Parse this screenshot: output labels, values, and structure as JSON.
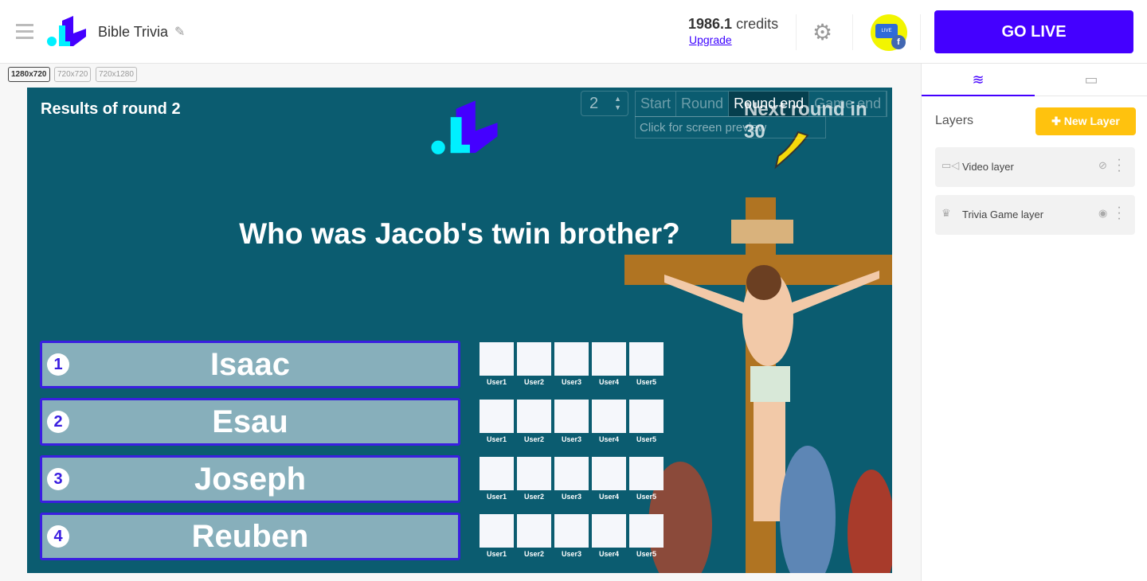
{
  "header": {
    "title": "Bible Trivia",
    "credits_value": "1986.1",
    "credits_label": "credits",
    "upgrade": "Upgrade",
    "go_live": "GO LIVE",
    "avatar_text": "LIVE",
    "avatar_badge": "f"
  },
  "resolutions": [
    {
      "label": "1280x720",
      "active": true
    },
    {
      "label": "720x720"
    },
    {
      "label": "720x1280"
    }
  ],
  "game": {
    "round_title": "Results of round 2",
    "question": "Who was Jacob's twin brother?",
    "round_number": "2",
    "stage_tabs": [
      "Start",
      "Round",
      "Round end",
      "Game end"
    ],
    "active_stage": "Round end",
    "preview": "Click for screen preview",
    "next_round": "Next round in 30",
    "answers": [
      {
        "num": "1",
        "text": "Isaac"
      },
      {
        "num": "2",
        "text": "Esau"
      },
      {
        "num": "3",
        "text": "Joseph"
      },
      {
        "num": "4",
        "text": "Reuben"
      }
    ],
    "users": [
      "User1",
      "User2",
      "User3",
      "User4",
      "User5"
    ]
  },
  "sidebar": {
    "layers_title": "Layers",
    "new_layer": "New Layer",
    "layers": [
      {
        "name": "Video layer",
        "icon": "video-camera-icon",
        "visible": false
      },
      {
        "name": "Trivia Game layer",
        "icon": "crown-icon",
        "visible": true
      }
    ]
  },
  "colors": {
    "accent": "#4400ff",
    "canvas": "#0b5c70",
    "answer": "#87afbb",
    "new_layer": "#ffc20e"
  }
}
